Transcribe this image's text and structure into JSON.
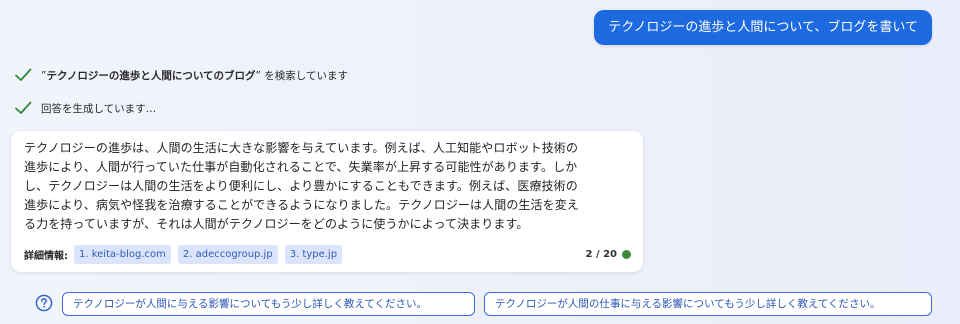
{
  "user_message": "テクノロジーの進歩と人間について、ブログを書いて",
  "status": [
    {
      "prefix": "”",
      "query": "テクノロジーの進歩と人間についてのブログ",
      "suffix": "” を検索しています"
    },
    {
      "text": "回答を生成しています…"
    }
  ],
  "answer": {
    "text": "テクノロジーの進歩は、人間の生活に大きな影響を与えています。例えば、人工知能やロボット技術の\n進歩により、人間が行っていた仕事が自動化されることで、失業率が上昇する可能性があります。しか\nし、テクノロジーは人間の生活をより便利にし、より豊かにすることもできます。例えば、医療技術の\n進歩により、病気や怪我を治療することができるようになりました。テクノロジーは人間の生活を変え\nる力を持っていますが、それは人間がテクノロジーをどのように使うかによって決まります。",
    "sources_label": "詳細情報:",
    "sources": [
      "1. keita-blog.com",
      "2. adeccogroup.jp",
      "3. type.jp"
    ],
    "count": "2 / 20"
  },
  "suggestions": [
    "テクノロジーが人間に与える影響についてもう少し詳しく教えてください。",
    "テクノロジーが人間の仕事に与える影響についてもう少し詳しく教えてください。"
  ],
  "colors": {
    "accent": "#1d69df",
    "check": "#2f8a3b",
    "status_dot": "#3b8a3c"
  },
  "icons": {
    "status_check": "check-icon",
    "help": "question-circle-icon"
  }
}
